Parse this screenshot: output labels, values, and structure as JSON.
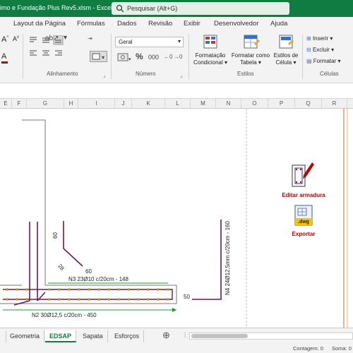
{
  "window": {
    "title": "imo e Fundação Plus Rev5.xlsm  -  Excel",
    "search_placeholder": "Pesquisar (Alt+G)"
  },
  "menu": {
    "tabs": [
      "Layout da Página",
      "Fórmulas",
      "Dados",
      "Revisão",
      "Exibir",
      "Desenvolvedor",
      "Ajuda"
    ]
  },
  "ribbon": {
    "alignment_group": "Alinhamento",
    "number_group": "Número",
    "number_format": "Geral",
    "styles_group": "Estilos",
    "cells_group": "Células",
    "conditional_format": [
      "Formatação",
      "Condicional"
    ],
    "format_table": [
      "Formatar como",
      "Tabela"
    ],
    "cell_styles": [
      "Estilos de",
      "Célula"
    ],
    "insert": "Inserir",
    "delete": "Excluir",
    "format": "Formatar",
    "percent": "%",
    "thousands": "000"
  },
  "columns": [
    "E",
    "F",
    "G",
    "H",
    "I",
    "J",
    "K",
    "L",
    "M",
    "N",
    "O",
    "P",
    "Q",
    "R"
  ],
  "drawing": {
    "label_60a": "60",
    "label_28": "28",
    "label_60b": "60",
    "label_n3": "N3 23Ø10 c/20cm - 148",
    "label_n2": "N2 30Ø12,5 c/20cm - 450",
    "label_50": "50",
    "label_n4": "N4 24Ø12,5mm c/20cm - 160",
    "edit_rebar": "Editar armadura",
    "export": "Exportar",
    "dwg": ".dwg"
  },
  "sheet_tabs": [
    "Geometria",
    "EDSAP",
    "Sapata",
    "Esforços"
  ],
  "active_tab": "EDSAP",
  "status": {
    "count": "Contagem: 0",
    "sum": "Soma: 0"
  },
  "colors": {
    "excel_green": "#107c41",
    "rebar_purple": "#6b1c4a",
    "dimension_green": "#1a9c2a",
    "accent_red": "#c00000"
  }
}
